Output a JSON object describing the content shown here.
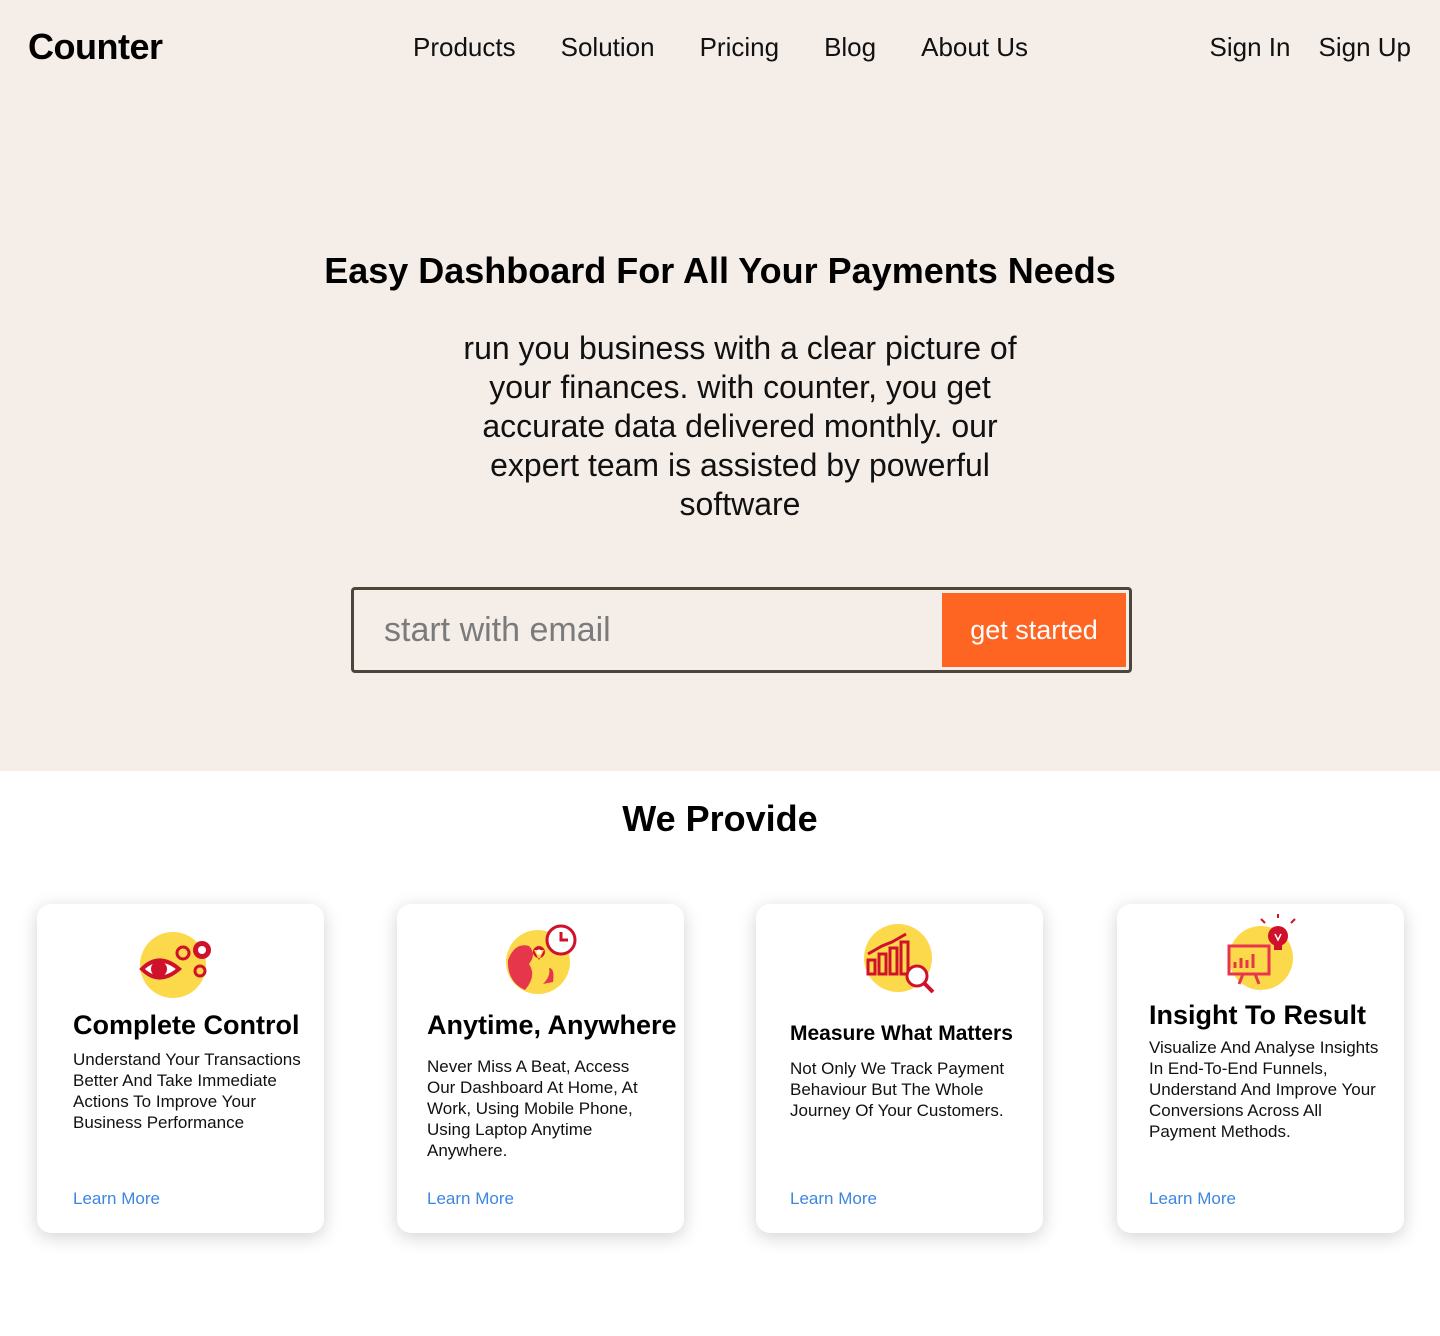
{
  "header": {
    "logo": "Counter",
    "nav": [
      "Products",
      "Solution",
      "Pricing",
      "Blog",
      "About Us"
    ],
    "auth": {
      "sign_in": "Sign In",
      "sign_up": "Sign Up"
    }
  },
  "hero": {
    "title": "Easy Dashboard For All Your Payments Needs",
    "description": "run you business with a clear picture of your finances. with counter, you get accurate data delivered monthly. our expert team is assisted by powerful software",
    "email_placeholder": "start with email",
    "email_value": "",
    "cta_label": "get started"
  },
  "features": {
    "title": "We Provide",
    "cards": [
      {
        "icon": "eye-gears-icon",
        "title": "Complete Control",
        "text": "Understand Your Transactions Better And Take Immediate Actions To Improve Your Business Performance",
        "link": "Learn More"
      },
      {
        "icon": "globe-location-clock-icon",
        "title": "Anytime, Anywhere",
        "text": "Never Miss A Beat, Access Our Dashboard At Home, At Work, Using Mobile Phone, Using Laptop Anytime Anywhere.",
        "link": "Learn More"
      },
      {
        "icon": "chart-magnifier-icon",
        "title": "Measure What Matters",
        "text": "Not Only We Track Payment Behaviour But The Whole Journey Of Your Customers.",
        "link": "Learn More"
      },
      {
        "icon": "presentation-lightbulb-icon",
        "title": "Insight To Result",
        "text": "Visualize And Analyse Insights In End-To-End Funnels, Understand And Improve Your Conversions Across All Payment Methods.",
        "link": "Learn More"
      }
    ]
  },
  "colors": {
    "hero_bg": "#f4ede8",
    "cta": "#ff6522",
    "link": "#3c86e0",
    "icon_yellow": "#fcd94a",
    "icon_red": "#d0112b"
  }
}
